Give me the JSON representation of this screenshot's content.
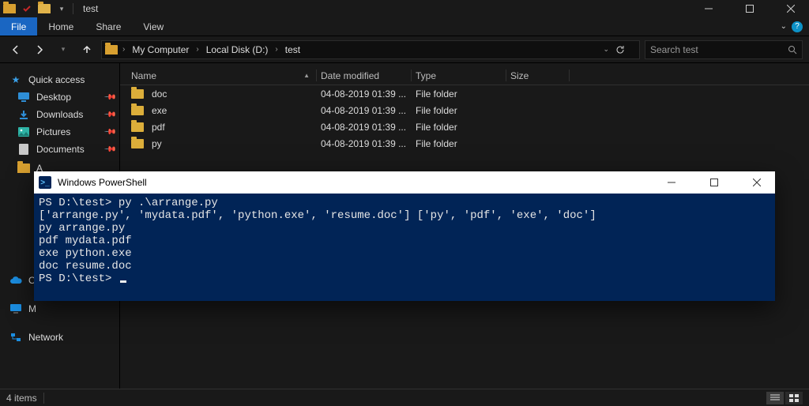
{
  "explorer": {
    "title": "test",
    "ribbon": {
      "file": "File",
      "home": "Home",
      "share": "Share",
      "view": "View"
    },
    "breadcrumbs": [
      "My Computer",
      "Local Disk (D:)",
      "test"
    ],
    "search_placeholder": "Search test",
    "tree": {
      "quick_access": "Quick access",
      "desktop": "Desktop",
      "downloads": "Downloads",
      "pictures": "Pictures",
      "documents": "Documents",
      "onedrive_initial": "O",
      "my_initial": "M",
      "network": "Network"
    },
    "columns": {
      "name": "Name",
      "modified": "Date modified",
      "type": "Type",
      "size": "Size"
    },
    "rows": [
      {
        "name": "doc",
        "modified": "04-08-2019 01:39 ...",
        "type": "File folder",
        "size": ""
      },
      {
        "name": "exe",
        "modified": "04-08-2019 01:39 ...",
        "type": "File folder",
        "size": ""
      },
      {
        "name": "pdf",
        "modified": "04-08-2019 01:39 ...",
        "type": "File folder",
        "size": ""
      },
      {
        "name": "py",
        "modified": "04-08-2019 01:39 ...",
        "type": "File folder",
        "size": ""
      }
    ],
    "status": "4 items"
  },
  "powershell": {
    "title": "Windows PowerShell",
    "lines": [
      "PS D:\\test> py .\\arrange.py",
      "['arrange.py', 'mydata.pdf', 'python.exe', 'resume.doc'] ['py', 'pdf', 'exe', 'doc']",
      "py arrange.py",
      "pdf mydata.pdf",
      "exe python.exe",
      "doc resume.doc",
      "PS D:\\test> "
    ]
  }
}
